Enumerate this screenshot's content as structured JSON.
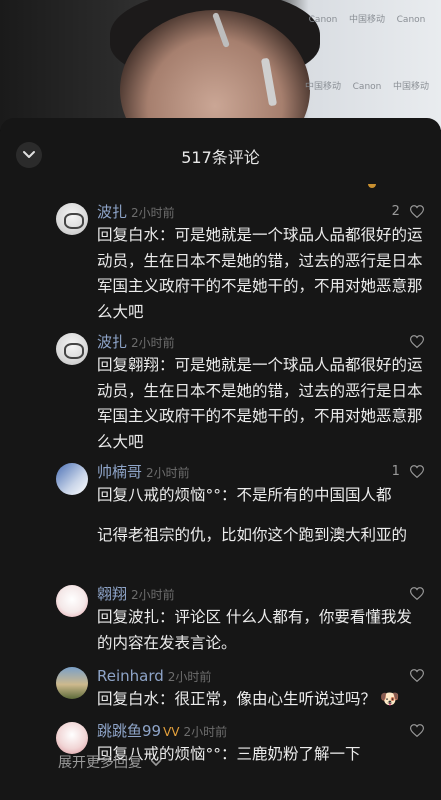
{
  "header": {
    "title": "517条评论"
  },
  "comments": [
    {
      "name": "波扎",
      "time": "2小时前",
      "likes": "2",
      "text": "回复白水：可是她就是一个球品人品都很好的运动员，生在日本不是她的错，过去的恶行是日本军国主义政府干的不是她干的，不用对她恶意那么大吧"
    },
    {
      "name": "波扎",
      "time": "2小时前",
      "likes": "",
      "text": "回复翱翔：可是她就是一个球品人品都很好的运动员，生在日本不是她的错，过去的恶行是日本军国主义政府干的不是她干的，不用对她恶意那么大吧"
    },
    {
      "name": "帅楠哥",
      "time": "2小时前",
      "likes": "1",
      "line1": "回复八戒的烦恼°°：不是所有的中国国人都",
      "line2": "记得老祖宗的仇，比如你这个跑到澳大利亚的"
    },
    {
      "name": "翱翔",
      "time": "2小时前",
      "likes": "",
      "text": "回复波扎：评论区 什么人都有，你要看懂我发的内容在发表言论。"
    },
    {
      "name": "Reinhard",
      "time": "2小时前",
      "likes": "",
      "text": "回复白水：很正常，像由心生听说过吗？",
      "emoji": "🐶"
    },
    {
      "name": "跳跳鱼99",
      "badge": "VV",
      "time": "2小时前",
      "likes": "",
      "text": "回复八戒的烦恼°°：三鹿奶粉了解一下"
    }
  ],
  "footer": {
    "more_label": "展开更多回复"
  },
  "background": {
    "sponsor_logos": [
      "Canon",
      "中国移动",
      "Canon",
      "中国移动",
      "Canon",
      "中国移动"
    ]
  }
}
